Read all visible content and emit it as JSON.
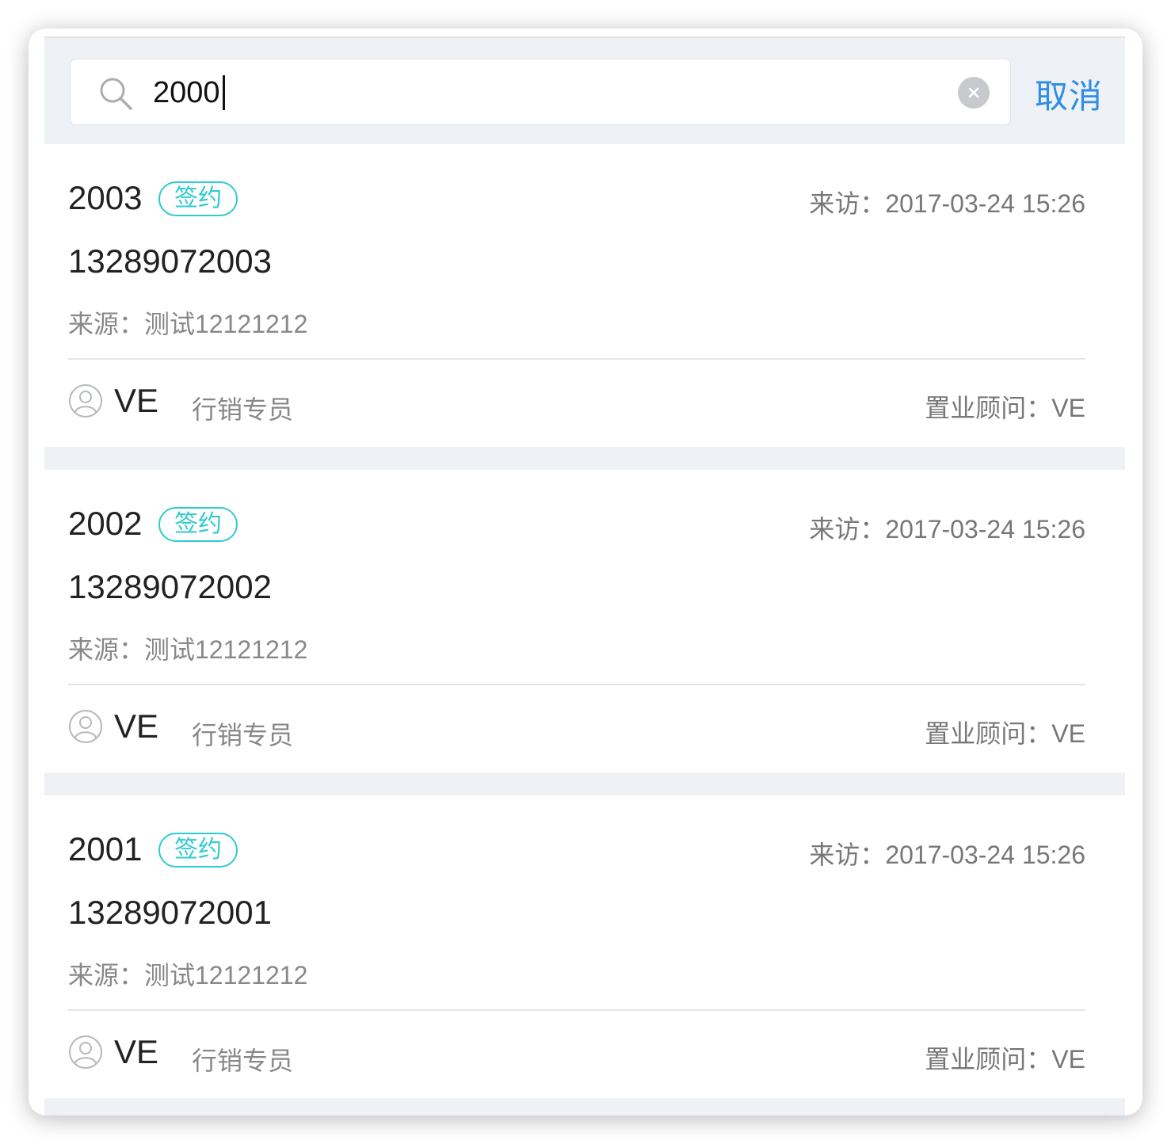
{
  "search": {
    "value": "2000",
    "cancel_label": "取消"
  },
  "results": [
    {
      "name": "2003",
      "status": "签约",
      "visit": "来访：2017-03-24 15:26",
      "phone": "13289072003",
      "source": "来源：测试12121212",
      "agent": "VE",
      "role": "行销专员",
      "advisor": "置业顾问：VE"
    },
    {
      "name": "2002",
      "status": "签约",
      "visit": "来访：2017-03-24 15:26",
      "phone": "13289072002",
      "source": "来源：测试12121212",
      "agent": "VE",
      "role": "行销专员",
      "advisor": "置业顾问：VE"
    },
    {
      "name": "2001",
      "status": "签约",
      "visit": "来访：2017-03-24 15:26",
      "phone": "13289072001",
      "source": "来源：测试12121212",
      "agent": "VE",
      "role": "行销专员",
      "advisor": "置业顾问：VE"
    }
  ],
  "colors": {
    "accent": "#2e8de6",
    "badge": "#2ecbcf",
    "background": "#eef1f5"
  }
}
